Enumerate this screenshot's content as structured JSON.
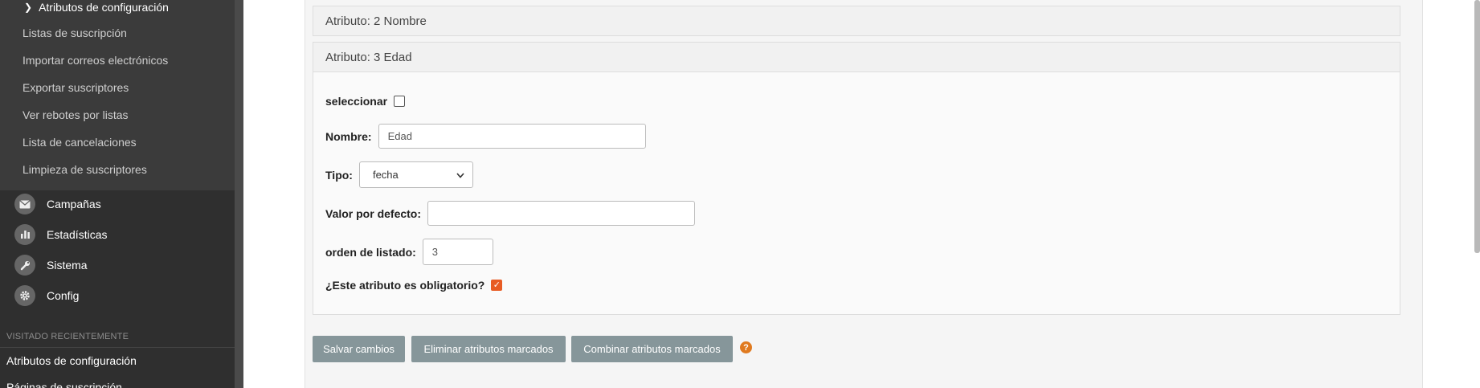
{
  "sidebar": {
    "active_sub": "Atributos de configuración",
    "sub_items": [
      "Listas de suscripción",
      "Importar correos electrónicos",
      "Exportar suscriptores",
      "Ver rebotes por listas",
      "Lista de cancelaciones",
      "Limpieza de suscriptores"
    ],
    "main_items": [
      {
        "label": "Campañas",
        "icon": "mail-icon"
      },
      {
        "label": "Estadísticas",
        "icon": "bar-chart-icon"
      },
      {
        "label": "Sistema",
        "icon": "wrench-icon"
      },
      {
        "label": "Config",
        "icon": "gear-icon"
      }
    ],
    "recent_title": "VISITADO RECIENTEMENTE",
    "recent_items": [
      "Atributos de configuración",
      "Páginas de suscripción"
    ]
  },
  "attributes": {
    "attr2_title": "Atributo: 2 Nombre",
    "attr3_title": "Atributo: 3 Edad"
  },
  "form": {
    "select_label": "seleccionar",
    "select_checked": false,
    "name_label": "Nombre:",
    "name_value": "Edad",
    "type_label": "Tipo:",
    "type_value": "fecha",
    "default_label": "Valor por defecto:",
    "default_value": "",
    "order_label": "orden de listado:",
    "order_value": "3",
    "required_label": "¿Este atributo es obligatorio?",
    "required_checked": true
  },
  "buttons": {
    "save": "Salvar cambios",
    "delete": "Eliminar atributos marcados",
    "merge": "Combinar atributos marcados"
  },
  "colors": {
    "accent": "#e85c24",
    "button": "#86969a",
    "sidebar": "#2f2f2f"
  }
}
